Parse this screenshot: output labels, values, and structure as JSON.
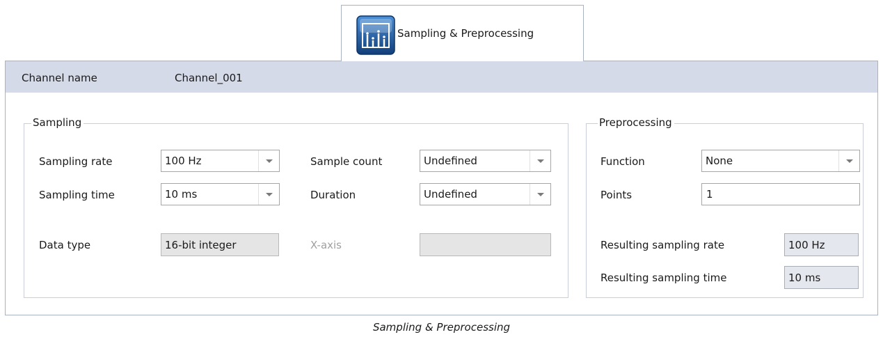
{
  "tab": {
    "label": "Sampling & Preprocessing",
    "icon": "sampling-chart-icon"
  },
  "header": {
    "channel_name_label": "Channel name",
    "channel_name_value": "Channel_001"
  },
  "sampling": {
    "legend": "Sampling",
    "sampling_rate": {
      "label": "Sampling rate",
      "value": "100 Hz"
    },
    "sampling_time": {
      "label": "Sampling time",
      "value": "10 ms"
    },
    "sample_count": {
      "label": "Sample count",
      "value": "Undefined"
    },
    "duration": {
      "label": "Duration",
      "value": "Undefined"
    },
    "data_type": {
      "label": "Data type",
      "value": "16-bit integer"
    },
    "x_axis": {
      "label": "X-axis",
      "value": ""
    }
  },
  "preprocessing": {
    "legend": "Preprocessing",
    "function": {
      "label": "Function",
      "value": "None"
    },
    "points": {
      "label": "Points",
      "value": "1"
    },
    "resulting_rate": {
      "label": "Resulting sampling rate",
      "value": "100 Hz"
    },
    "resulting_time": {
      "label": "Resulting sampling time",
      "value": "10 ms"
    }
  },
  "caption": "Sampling & Preprocessing",
  "colors": {
    "header_bg": "#d4dae8",
    "icon_blue": "#1f5fa8",
    "readonly_bg": "#e4e7ed"
  }
}
